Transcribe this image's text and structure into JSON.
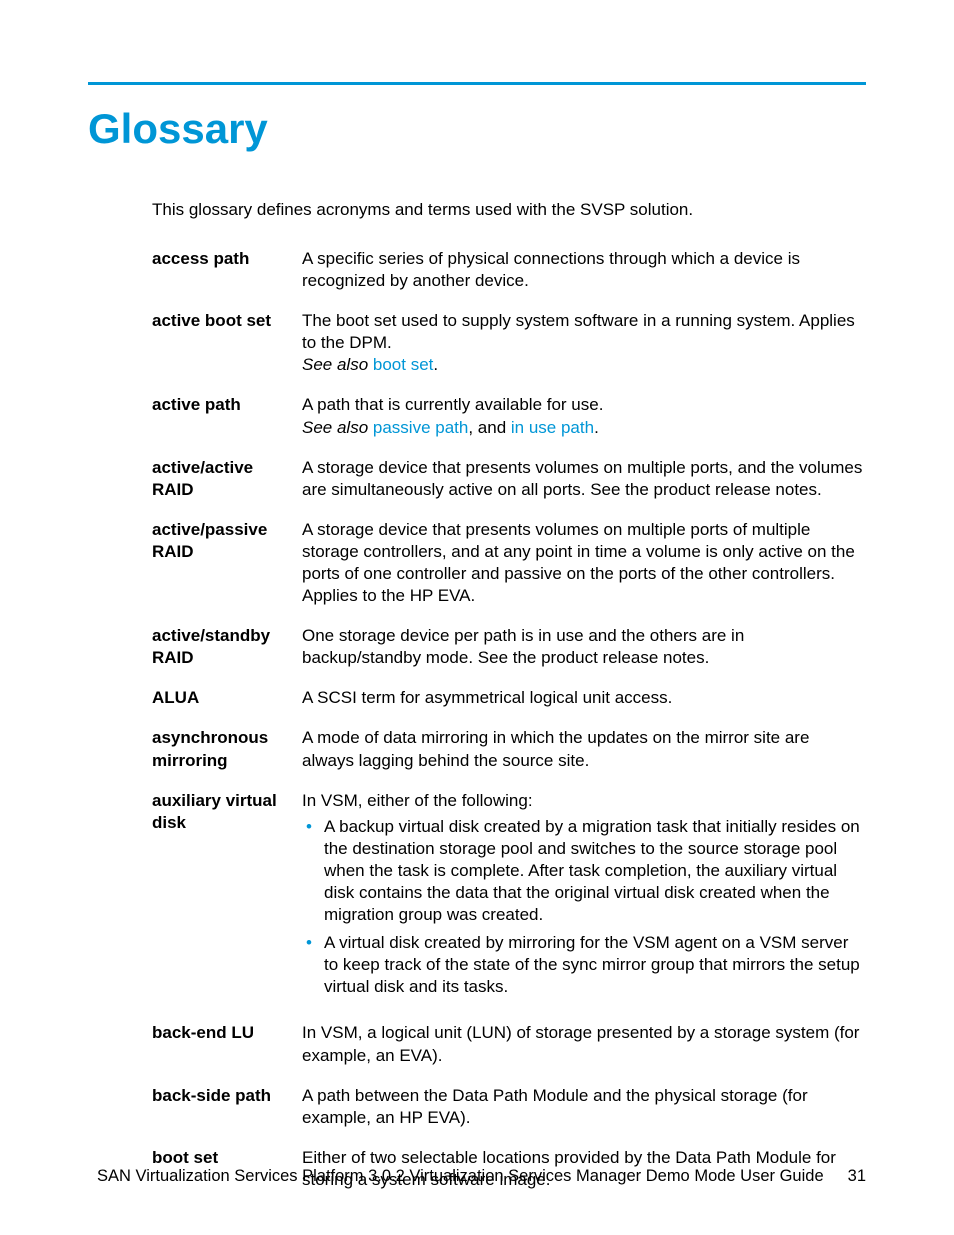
{
  "title": "Glossary",
  "intro": "This glossary defines acronyms and terms used with the SVSP solution.",
  "see_also_label": "See also",
  "and_label": ", and ",
  "period": ".",
  "entries": [
    {
      "term": "access path",
      "def": "A specific series of physical connections through which a device is recognized by another device."
    },
    {
      "term": "active boot set",
      "def": "The boot set used to supply system software in a running system. Applies to the DPM.",
      "see_also": [
        "boot set"
      ]
    },
    {
      "term": "active path",
      "def": "A path that is currently available for use.",
      "see_also": [
        "passive path",
        "in use path"
      ]
    },
    {
      "term": "active/active RAID",
      "def": "A storage device that presents volumes on multiple ports, and the volumes are simultaneously active on all ports. See the product release notes."
    },
    {
      "term": "active/passive RAID",
      "def": "A storage device that presents volumes on multiple ports of multiple storage controllers, and at any point in time a volume is only active on the ports of one controller and passive on the ports of the other controllers. Applies to the HP EVA."
    },
    {
      "term": "active/standby RAID",
      "def": "One storage device per path is in use and the others are in backup/standby mode. See the product release notes."
    },
    {
      "term": "ALUA",
      "def": "A SCSI term for asymmetrical logical unit access."
    },
    {
      "term": "asynchronous mirroring",
      "def": "A mode of data mirroring in which the updates on the mirror site are always lagging behind the source site."
    },
    {
      "term": "auxiliary virtual disk",
      "def": "In VSM, either of the following:",
      "bullets": [
        "A backup virtual disk created by a migration task that initially resides on the destination storage pool and switches to the source storage pool when the task is complete. After task completion, the auxiliary virtual disk contains the data that the original virtual disk created when the migration group was created.",
        "A virtual disk created by mirroring for the VSM agent on a VSM server to keep track of the state of the sync mirror group that mirrors the setup virtual disk and its tasks."
      ]
    },
    {
      "term": "back-end LU",
      "def": "In VSM, a logical unit (LUN) of storage presented by a storage system (for example, an EVA)."
    },
    {
      "term": "back-side path",
      "def": "A path between the Data Path Module and the physical storage (for example, an HP EVA)."
    },
    {
      "term": "boot set",
      "def": "Either of two selectable locations provided by the Data Path Module for storing a system software image."
    }
  ],
  "footer": {
    "doc_title": "SAN Virtualization Services Platform 3.0.2 Virtualization Services Manager Demo Mode User Guide",
    "page_number": "31"
  }
}
